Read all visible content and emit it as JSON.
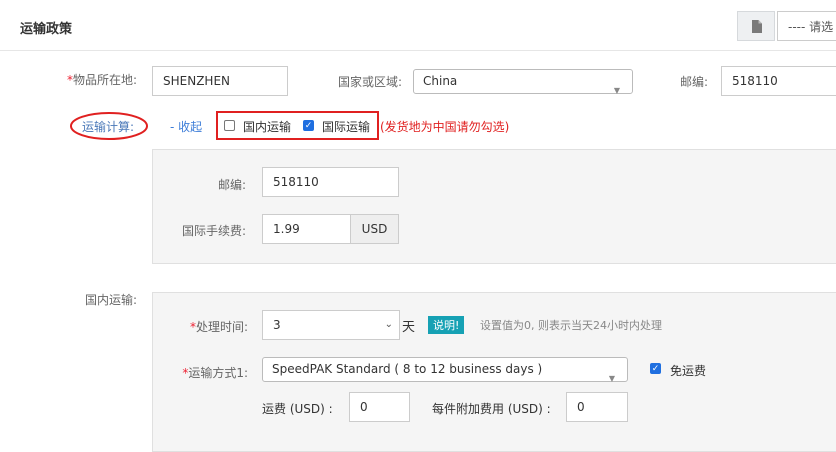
{
  "header": {
    "title": "运输政策",
    "select_text": "---- 请选"
  },
  "location": {
    "label": "*物品所在地:",
    "value": "SHENZHEN",
    "country_label": "国家或区域:",
    "country_value": "China",
    "zip_label": "邮编:",
    "zip_value": "518110"
  },
  "calc": {
    "label": "运输计算:",
    "collapse": "- 收起",
    "domestic_label": "国内运输",
    "domestic_checked": false,
    "intl_label": "国际运输",
    "intl_checked": true,
    "note": "(发货地为中国请勿勾选)"
  },
  "calc_panel": {
    "zip_label": "邮编:",
    "zip_value": "518110",
    "fee_label": "国际手续费:",
    "fee_value": "1.99",
    "fee_unit": "USD"
  },
  "domestic": {
    "label": "国内运输:",
    "handling_label": "*处理时间:",
    "handling_value": "3",
    "day_unit": "天",
    "tip_badge": "说明!",
    "tip_text": "设置值为0, 则表示当天24小时内处理",
    "method_label": "*运输方式1:",
    "method_value": "SpeedPAK Standard ( 8 to 12 business days )",
    "free_label": "免运费",
    "free_checked": true,
    "cost_label": "运费 (USD) :",
    "cost_value": "0",
    "extra_label": "每件附加费用 (USD) :",
    "extra_value": "0"
  },
  "colors": {
    "annotation_red": "#e02020",
    "checkbox_blue": "#1f6fe0",
    "tip_teal": "#16a1b4"
  }
}
